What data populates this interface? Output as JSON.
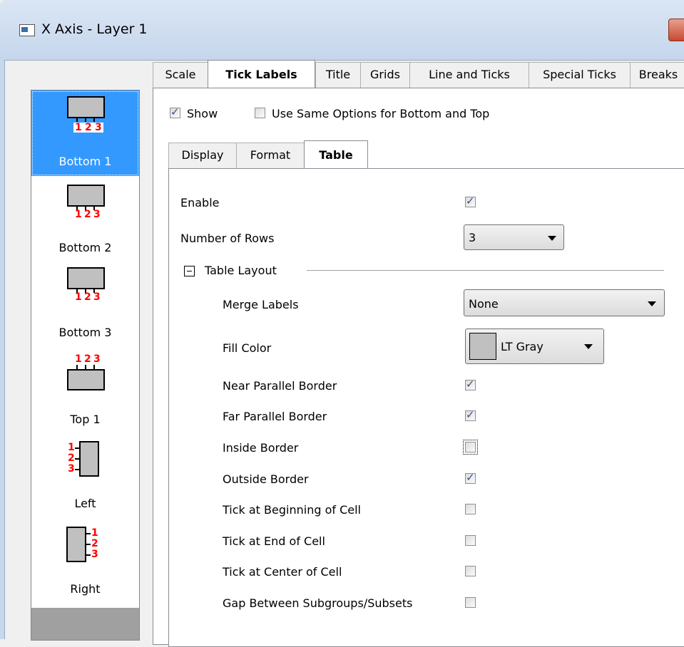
{
  "window": {
    "title": "X Axis - Layer 1"
  },
  "sidebar": {
    "items": [
      {
        "label": "Bottom 1",
        "selected": true
      },
      {
        "label": "Bottom 2",
        "selected": false
      },
      {
        "label": "Bottom 3",
        "selected": false
      },
      {
        "label": "Top 1",
        "selected": false
      },
      {
        "label": "Left",
        "selected": false
      },
      {
        "label": "Right",
        "selected": false
      }
    ],
    "icon_digits": [
      "1",
      "2",
      "3"
    ]
  },
  "tabs": [
    "Scale",
    "Tick Labels",
    "Title",
    "Grids",
    "Line and Ticks",
    "Special Ticks",
    "Breaks"
  ],
  "active_tab": "Tick Labels",
  "options": {
    "show_label": "Show",
    "show_checked": true,
    "same_options_label": "Use Same Options for Bottom and Top",
    "same_options_checked": false
  },
  "subtabs": [
    "Display",
    "Format",
    "Table"
  ],
  "active_subtab": "Table",
  "table": {
    "enable_label": "Enable",
    "enable_checked": true,
    "rows_label": "Number of Rows",
    "rows_value": "3",
    "layout_label": "Table Layout",
    "merge_label": "Merge Labels",
    "merge_value": "None",
    "fill_label": "Fill Color",
    "fill_value": "LT Gray",
    "fill_color": "#c0c0c0",
    "checks": [
      {
        "label": "Near Parallel Border",
        "checked": true
      },
      {
        "label": "Far Parallel Border",
        "checked": true
      },
      {
        "label": "Inside Border",
        "checked": false
      },
      {
        "label": "Outside Border",
        "checked": true
      },
      {
        "label": "Tick at Beginning of Cell",
        "checked": false
      },
      {
        "label": "Tick at End of Cell",
        "checked": false
      },
      {
        "label": "Tick at Center of Cell",
        "checked": false
      },
      {
        "label": "Gap Between Subgroups/Subsets",
        "checked": false
      }
    ]
  },
  "colors": {
    "selection": "#3399ff",
    "digits": "#ff0000",
    "titlebar": "#c5d6ec"
  }
}
